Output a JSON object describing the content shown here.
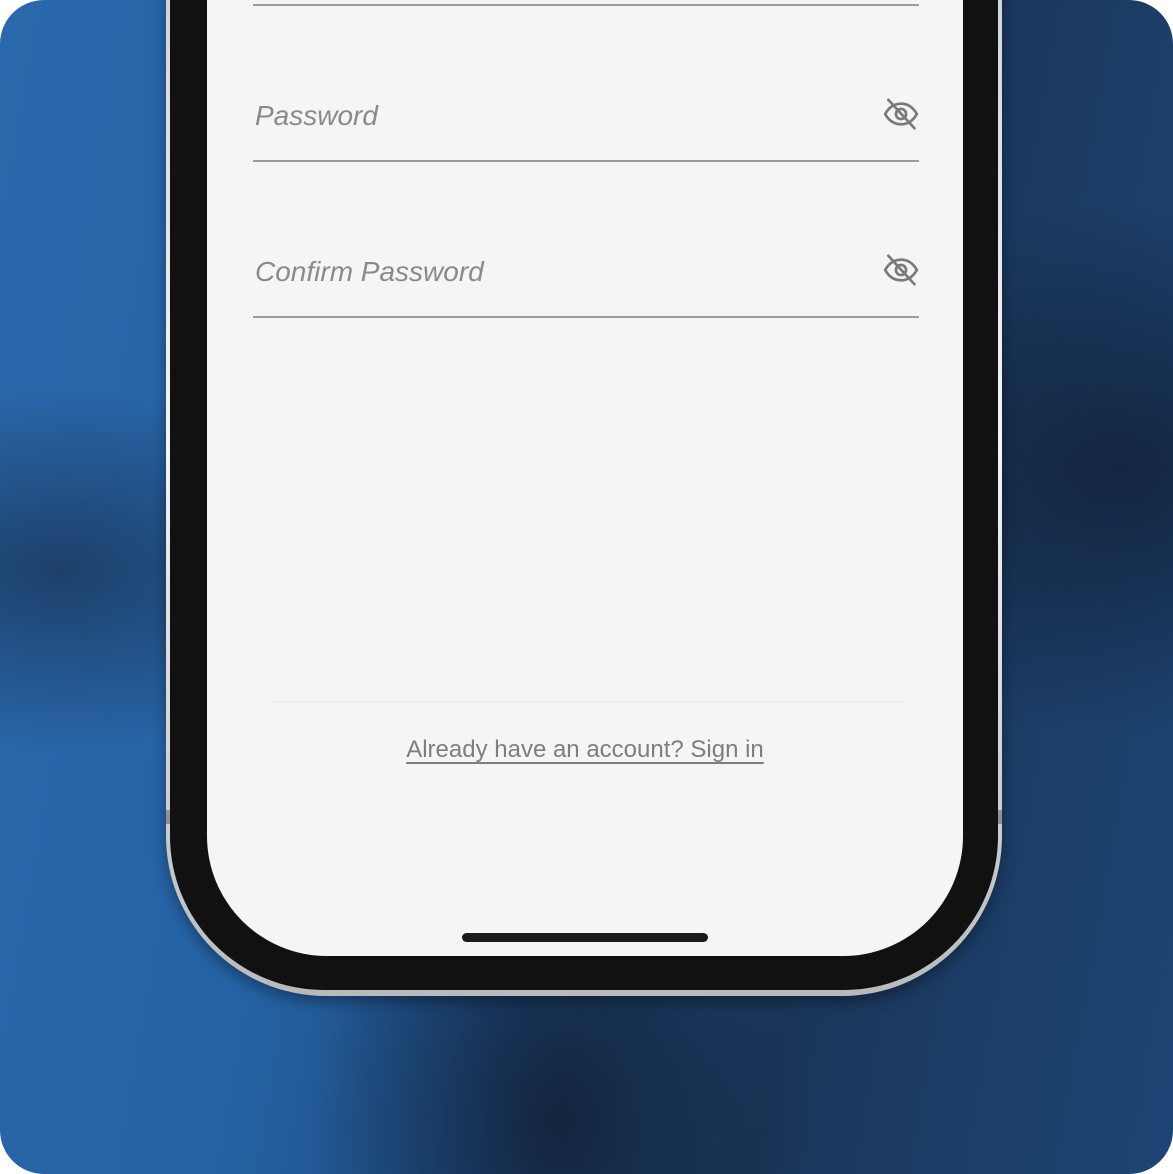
{
  "form": {
    "password": {
      "placeholder": "Password",
      "value": "",
      "toggle_icon": "eye-off-icon"
    },
    "confirm_password": {
      "placeholder": "Confirm Password",
      "value": "",
      "toggle_icon": "eye-off-icon"
    }
  },
  "footer": {
    "signin_text": "Already have an account? Sign in"
  },
  "colors": {
    "screen_background": "#f5f5f5",
    "placeholder_text": "#8a8a8a",
    "underline": "#9b9b9b",
    "link_text": "#7e7e7e",
    "bezel": "#111111",
    "backdrop_blue": "#2562a3",
    "backdrop_navy": "#1a2d4c"
  }
}
